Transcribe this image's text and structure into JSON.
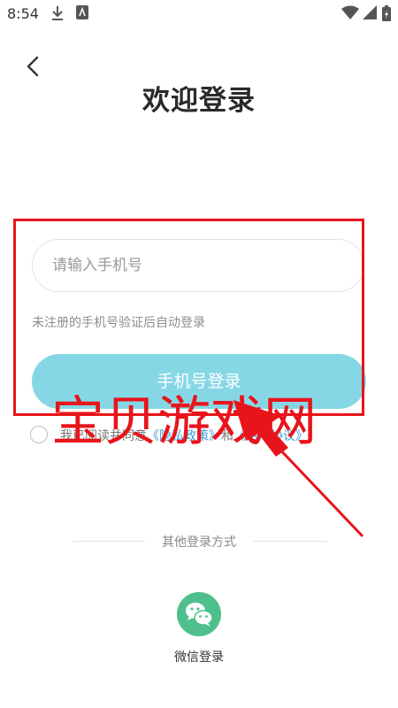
{
  "status_bar": {
    "time": "8:54"
  },
  "header": {
    "title": "欢迎登录"
  },
  "form": {
    "phone_placeholder": "请输入手机号",
    "phone_value": "",
    "hint": "未注册的手机号验证后自动登录",
    "login_button": "手机号登录",
    "agreement": {
      "checked": false,
      "prefix": "我已阅读并同意",
      "privacy_link": "《隐私政策》",
      "conjunction": "和",
      "user_link": "《用户协议》"
    }
  },
  "other_login": {
    "label": "其他登录方式",
    "wechat_label": "微信登录",
    "wechat_icon": "wechat-icon"
  },
  "overlay": {
    "watermark": "宝贝游戏网",
    "color": "#e8141b"
  },
  "colors": {
    "accent_button": "#86d7e6",
    "link": "#3a9fd8",
    "wechat": "#4fc08d"
  }
}
